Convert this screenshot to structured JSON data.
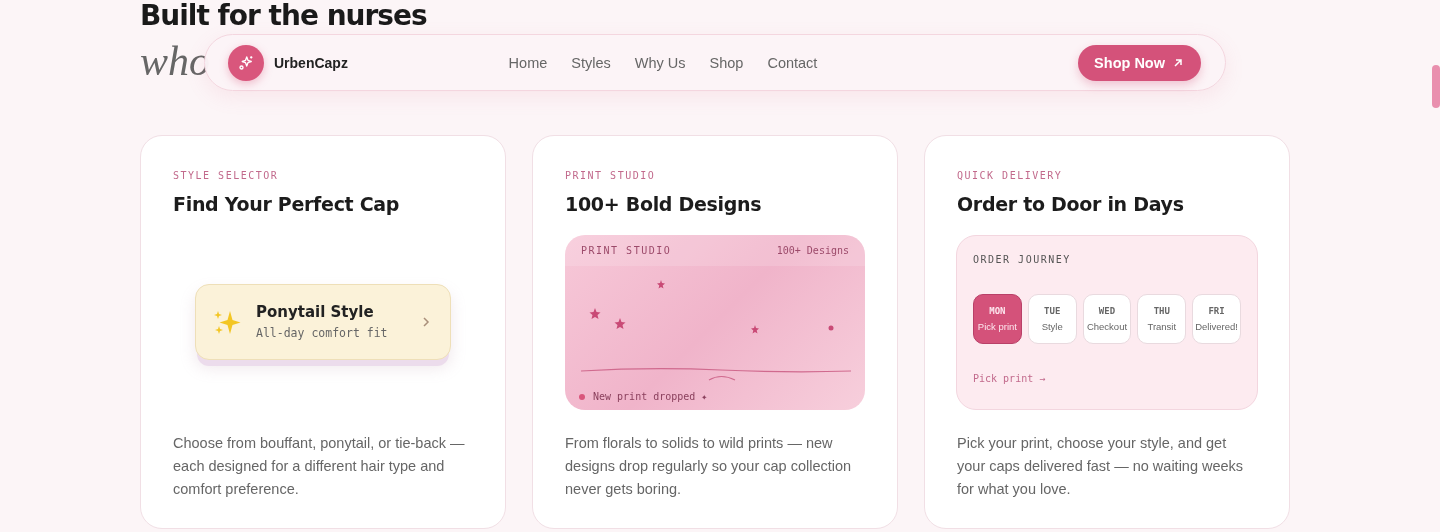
{
  "hero": {
    "title": "Built for the nurses",
    "subtitle": "who"
  },
  "nav": {
    "brand": "UrbenCapz",
    "links": [
      "Home",
      "Styles",
      "Why Us",
      "Shop",
      "Contact"
    ],
    "cta": "Shop Now"
  },
  "cards": [
    {
      "kind": "selector",
      "eyebrow": "STYLE SELECTOR",
      "title": "Find Your Perfect Cap",
      "option": {
        "title": "Ponytail Style",
        "subtitle": "All-day comfort fit"
      },
      "description": "Choose from bouffant, ponytail, or tie-back — each designed for a different hair type and comfort preference."
    },
    {
      "kind": "studio",
      "eyebrow": "PRINT STUDIO",
      "title": "100+ Bold Designs",
      "studio": {
        "label": "PRINT STUDIO",
        "count": "100+ Designs",
        "toast": "New print dropped ✦"
      },
      "description": "From florals to solids to wild prints — new designs drop regularly so your cap collection never gets boring."
    },
    {
      "kind": "journey",
      "eyebrow": "QUICK DELIVERY",
      "title": "Order to Door in Days",
      "journey": {
        "label": "ORDER JOURNEY",
        "days": [
          {
            "day": "MON",
            "step": "Pick print",
            "selected": true
          },
          {
            "day": "TUE",
            "step": "Style",
            "selected": false
          },
          {
            "day": "WED",
            "step": "Checkout",
            "selected": false
          },
          {
            "day": "THU",
            "step": "Transit",
            "selected": false
          },
          {
            "day": "FRI",
            "step": "Delivered!",
            "selected": false
          }
        ],
        "footer": "Pick print →"
      },
      "description": "Pick your print, choose your style, and get your caps delivered fast — no waiting weeks for what you love."
    }
  ]
}
